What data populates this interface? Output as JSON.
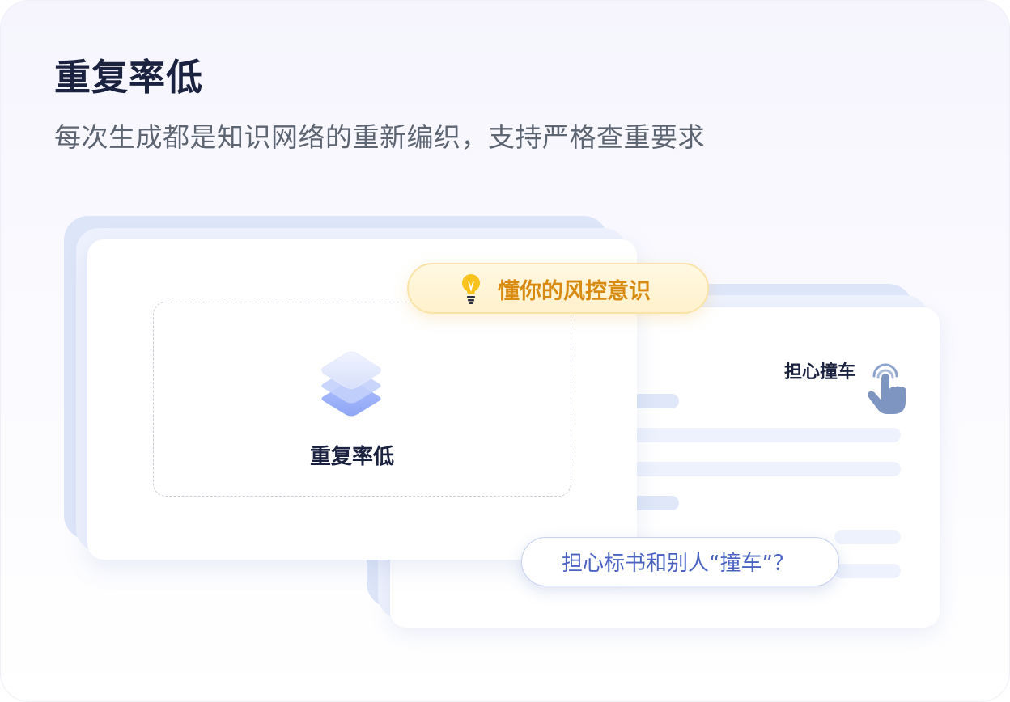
{
  "header": {
    "title": "重复率低",
    "subtitle": "每次生成都是知识网络的重新编织，支持严格查重要求"
  },
  "center_card": {
    "label": "重复率低",
    "icon": "layers-icon"
  },
  "risk_badge": {
    "label": "懂你的风控意识",
    "icon": "lightbulb-icon"
  },
  "side_card": {
    "worry_label": "担心撞车",
    "icon": "pointing-hand-icon"
  },
  "question_badge": {
    "label": "担心标书和别人“撞车”？"
  },
  "colors": {
    "title": "#1b2240",
    "accent_blue": "#4a62c2",
    "accent_orange": "#d98a10"
  }
}
